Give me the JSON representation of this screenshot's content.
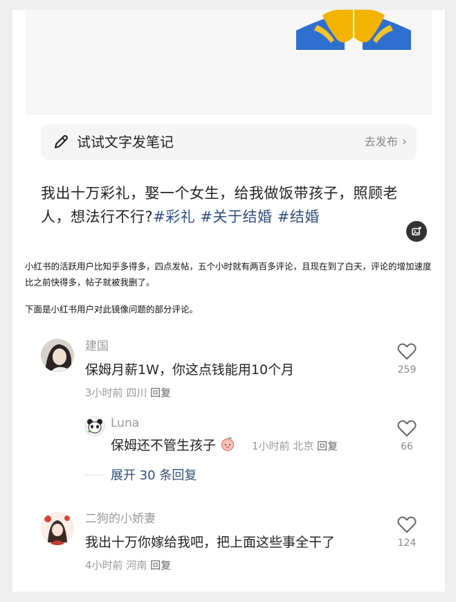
{
  "write_bar": {
    "text": "试试文字发笔记",
    "publish_label": "去发布",
    "icon": "pen-icon"
  },
  "post": {
    "text": "我出十万彩礼，娶一个女生，给我做饭带孩子，照顾老人，想法行不行?",
    "tags": [
      "#彩礼",
      "#关于结婚",
      "#结婚"
    ]
  },
  "notes": [
    "小红书的活跃用户比知乎多得多，四点发帖，五个小时就有两百多评论，且现在到了白天，评论的增加速度比之前快得多，帖子就被我删了。",
    "下面是小红书用户对此镜像问题的部分评论。"
  ],
  "comments": [
    {
      "name": "建国",
      "text": "保姆月薪1W，你这点钱能用10个月",
      "time": "3小时前",
      "location": "四川",
      "reply": "回复",
      "likes": "259"
    },
    {
      "name": "Luna",
      "text": "保姆还不管生孩子",
      "time": "1小时前",
      "location": "北京",
      "reply": "回复",
      "likes": "66"
    },
    {
      "name": "二狗的小娇妻",
      "text": "我出十万你嫁给我吧，把上面这些事全干了",
      "time": "4小时前",
      "location": "河南",
      "reply": "回复",
      "likes": "124"
    }
  ],
  "expand_replies": "展开 30 条回复",
  "colors": {
    "tag": "#2f4f7a",
    "meta": "#999999",
    "hands_yellow": "#f2b400",
    "hands_blue": "#2f6fd0"
  }
}
